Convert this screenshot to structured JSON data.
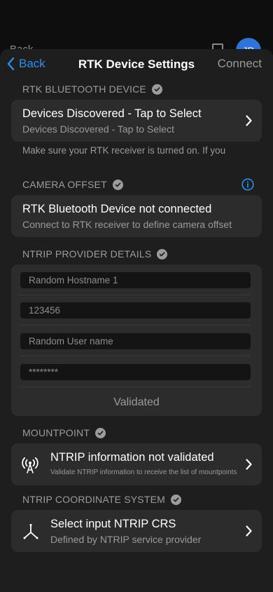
{
  "background": {
    "back_label": "Back",
    "avatar_initials": "JD"
  },
  "nav": {
    "back_label": "Back",
    "title": "RTK Device Settings",
    "connect_label": "Connect"
  },
  "rtk_device": {
    "header": "RTK BLUETOOTH DEVICE",
    "title": "Devices Discovered - Tap to Select",
    "subtitle": "Devices Discovered - Tap to Select",
    "hint": "Make sure your RTK receiver is turned on. If you"
  },
  "camera_offset": {
    "header": "CAMERA OFFSET",
    "title": "RTK Bluetooth Device not connected",
    "subtitle": "Connect to RTK receiver to define camera offset"
  },
  "ntrip_provider": {
    "header": "NTRIP PROVIDER DETAILS",
    "hostname_value": "Random Hostname 1",
    "port_value": "123456",
    "username_value": "Random User name",
    "password_value": "********",
    "status": "Validated"
  },
  "mountpoint": {
    "header": "MOUNTPOINT",
    "title": "NTRIP information not validated",
    "subtitle": "Validate NTRIP information to receive the list of mountpoints"
  },
  "coordinate_system": {
    "header": "NTRIP COORDINATE SYSTEM",
    "title": "Select input NTRIP CRS",
    "subtitle": "Defined by NTRIP service provider"
  },
  "colors": {
    "accent": "#2b8ef0",
    "sheet_background": "#1e1e1e",
    "card_background": "#2c2c2c"
  }
}
